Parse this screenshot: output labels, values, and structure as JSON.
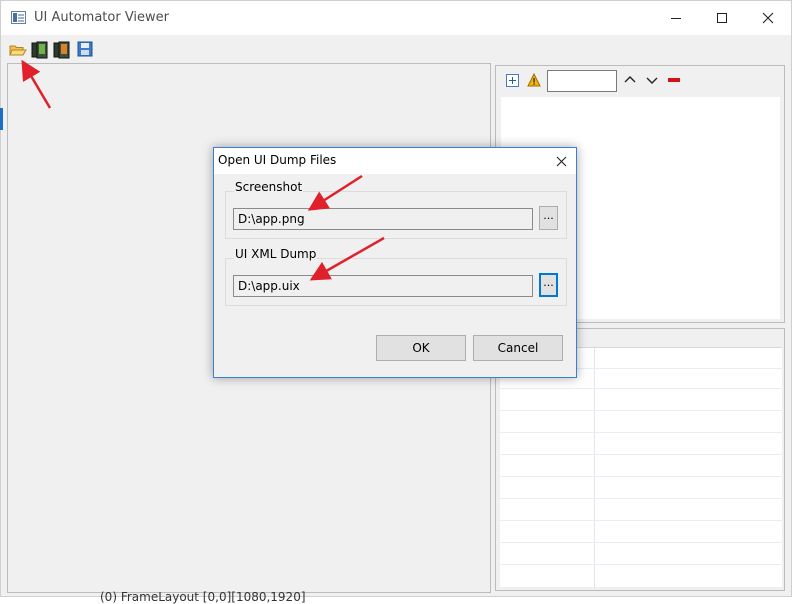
{
  "window": {
    "title": "UI Automator Viewer"
  },
  "toolbar": {
    "icons": [
      "open-folder-icon",
      "device-screenshot-icon",
      "device-screenshot-compressed-icon",
      "save-icon"
    ]
  },
  "attribute_panel": {
    "search_value": ""
  },
  "dialog": {
    "title": "Open UI Dump Files",
    "screenshot_label": "Screenshot",
    "screenshot_path": "D:\\app.png",
    "xml_label": "UI XML Dump",
    "xml_path": "D:\\app.uix",
    "browse_label": "...",
    "ok_label": "OK",
    "cancel_label": "Cancel"
  },
  "background": {
    "bottom_text": "(0) FrameLayout [0,0][1080,1920]"
  },
  "colors": {
    "accent": "#0078d7",
    "arrow": "#e0202a",
    "remove": "#d0141c"
  }
}
